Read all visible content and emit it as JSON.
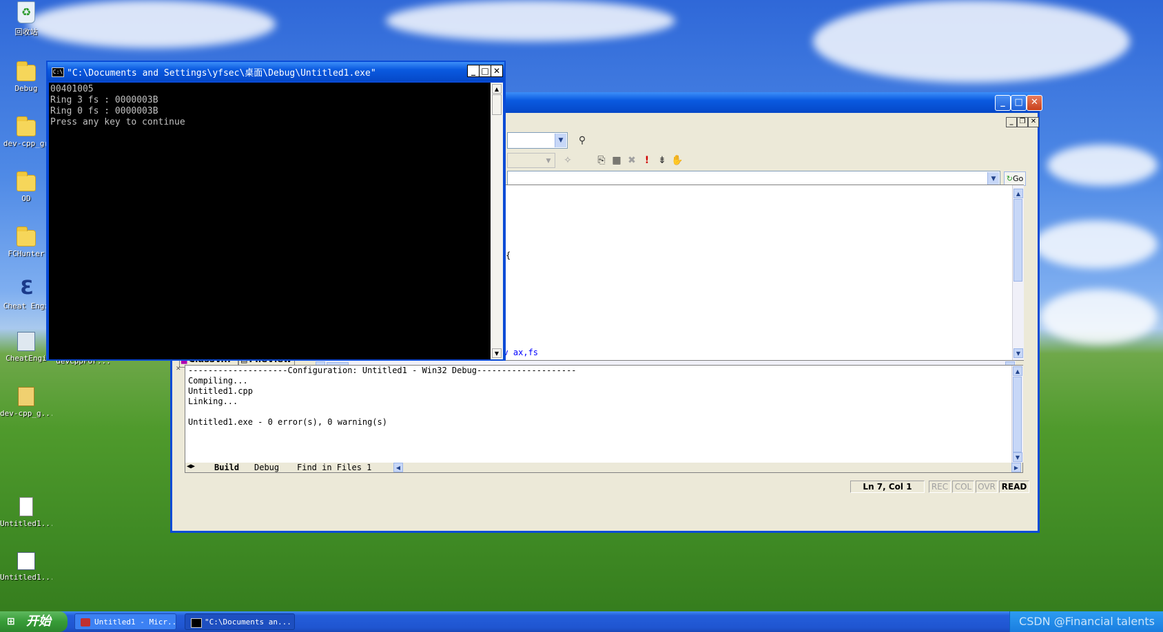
{
  "desktop": {
    "icons": [
      {
        "label": "回收站",
        "icon": "recycle-bin-icon"
      },
      {
        "label": "Debug",
        "icon": "folder-icon"
      },
      {
        "label": "dev-cpp_gr",
        "icon": "folder-icon"
      },
      {
        "label": "OD",
        "icon": "folder-icon"
      },
      {
        "label": "FCHunter",
        "icon": "folder-icon"
      },
      {
        "label": "Cheat Engi",
        "icon": "cheat-engine-icon"
      },
      {
        "label": "CheatEngi",
        "icon": "installer-icon"
      },
      {
        "label": "devcppFor...",
        "icon": "file-icon"
      },
      {
        "label": "dev-cpp_g...",
        "icon": "archive-icon"
      },
      {
        "label": "Untitled1...",
        "icon": "text-file-icon"
      },
      {
        "label": "Untitled1...",
        "icon": "workspace-file-icon"
      }
    ]
  },
  "console": {
    "title": "\"C:\\Documents and Settings\\yfsec\\桌面\\Debug\\Untitled1.exe\"",
    "lines": [
      "00401005",
      "Ring 3 fs : 0000003B",
      "Ring 0 fs : 0000003B",
      "Press any key to continue"
    ]
  },
  "ide": {
    "go_label": "Go",
    "editor_lines": [
      "{",
      "mov ax,fs"
    ],
    "workspace_tabs": [
      "ClassV...",
      "FileView"
    ],
    "output_lines": [
      "--------------------Configuration: Untitled1 - Win32 Debug--------------------",
      "Compiling...",
      "Untitled1.cpp",
      "Linking...",
      "",
      "Untitled1.exe - 0 error(s), 0 warning(s)"
    ],
    "output_tabs": [
      "Build",
      "Debug",
      "Find in Files 1"
    ],
    "status": {
      "position": "Ln 7, Col 1",
      "rec": "REC",
      "col": "COL",
      "ovr": "OVR",
      "read": "READ"
    }
  },
  "taskbar": {
    "start_label": "开始",
    "tasks": [
      "Untitled1 - Micr...",
      "\"C:\\Documents an..."
    ],
    "watermark": "CSDN @Financial talents"
  },
  "colors": {
    "xp_blue": "#0a4bd6",
    "console_bg": "#000000",
    "console_text": "#c0c0c0",
    "code_blue": "#0000ff"
  }
}
